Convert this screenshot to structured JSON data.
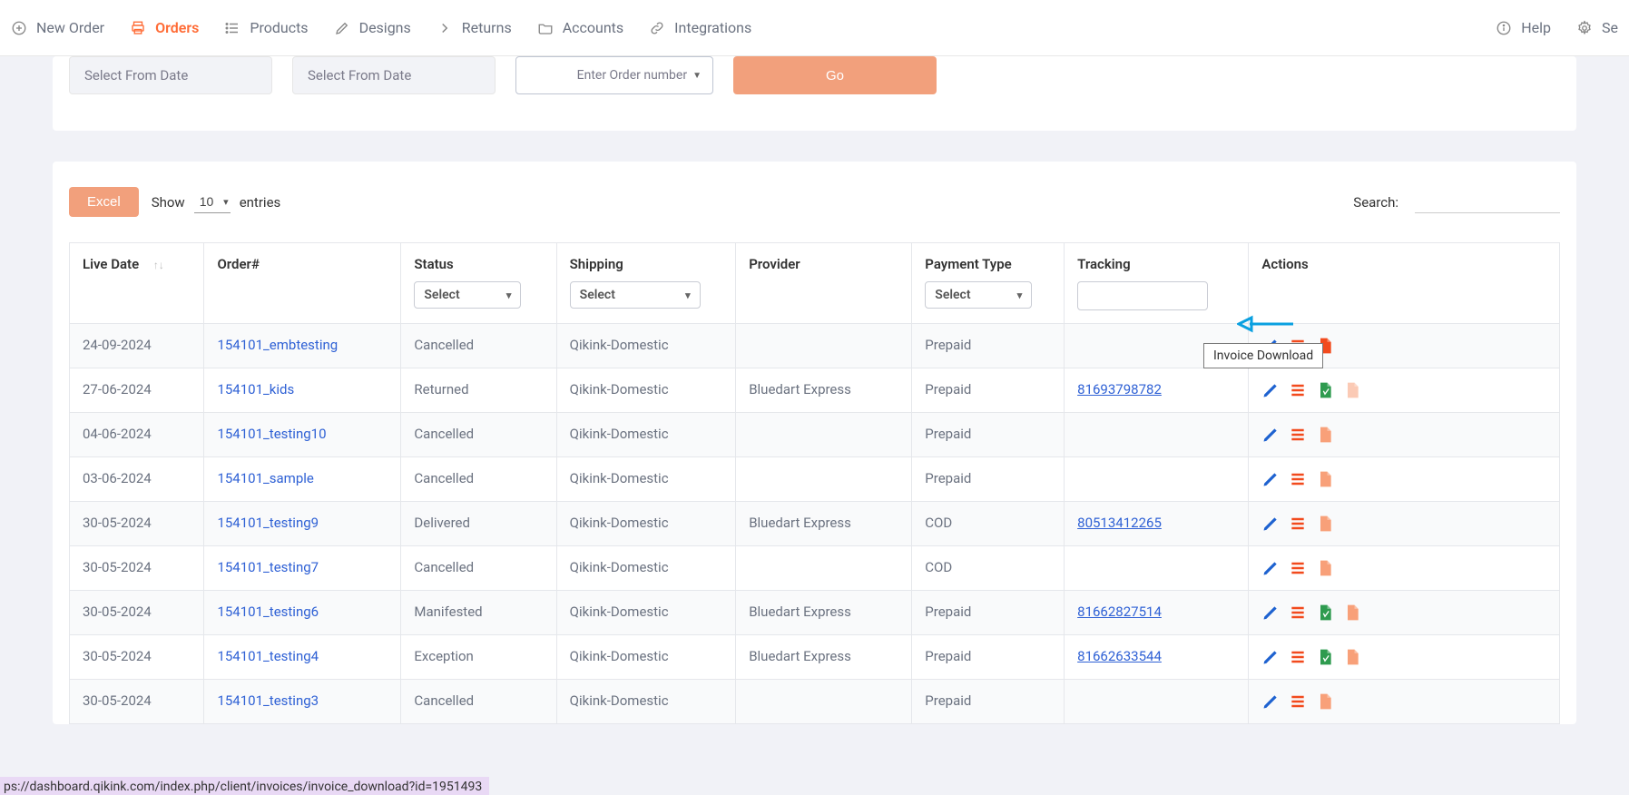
{
  "nav": {
    "new_order": "New Order",
    "orders": "Orders",
    "products": "Products",
    "designs": "Designs",
    "returns": "Returns",
    "accounts": "Accounts",
    "integrations": "Integrations",
    "help": "Help",
    "settings_short": "Se"
  },
  "filters": {
    "from_date": "Select From Date",
    "to_date": "Select From Date",
    "order_number_placeholder": "Enter Order number",
    "go": "Go"
  },
  "table_controls": {
    "excel": "Excel",
    "show": "Show",
    "entries_value": "10",
    "entries_label": "entries",
    "search_label": "Search:"
  },
  "columns": {
    "live_date": "Live Date",
    "order": "Order#",
    "status": "Status",
    "shipping": "Shipping",
    "provider": "Provider",
    "payment_type": "Payment Type",
    "tracking": "Tracking",
    "actions": "Actions",
    "select_placeholder": "Select"
  },
  "rows": [
    {
      "date": "24-09-2024",
      "order": "154101_embtesting",
      "status": "Cancelled",
      "shipping": "Qikink-Domestic",
      "provider": "",
      "payment": "Prepaid",
      "tracking": "",
      "has_pdf": false,
      "invoice_solid": true
    },
    {
      "date": "27-06-2024",
      "order": "154101_kids",
      "status": "Returned",
      "shipping": "Qikink-Domestic",
      "provider": "Bluedart Express",
      "payment": "Prepaid",
      "tracking": "81693798782",
      "has_pdf": true,
      "invoice_solid": false
    },
    {
      "date": "04-06-2024",
      "order": "154101_testing10",
      "status": "Cancelled",
      "shipping": "Qikink-Domestic",
      "provider": "",
      "payment": "Prepaid",
      "tracking": "",
      "has_pdf": false,
      "invoice_solid": false
    },
    {
      "date": "03-06-2024",
      "order": "154101_sample",
      "status": "Cancelled",
      "shipping": "Qikink-Domestic",
      "provider": "",
      "payment": "Prepaid",
      "tracking": "",
      "has_pdf": false,
      "invoice_solid": false
    },
    {
      "date": "30-05-2024",
      "order": "154101_testing9",
      "status": "Delivered",
      "shipping": "Qikink-Domestic",
      "provider": "Bluedart Express",
      "payment": "COD",
      "tracking": "80513412265",
      "has_pdf": false,
      "invoice_solid": false
    },
    {
      "date": "30-05-2024",
      "order": "154101_testing7",
      "status": "Cancelled",
      "shipping": "Qikink-Domestic",
      "provider": "",
      "payment": "COD",
      "tracking": "",
      "has_pdf": false,
      "invoice_solid": false
    },
    {
      "date": "30-05-2024",
      "order": "154101_testing6",
      "status": "Manifested",
      "shipping": "Qikink-Domestic",
      "provider": "Bluedart Express",
      "payment": "Prepaid",
      "tracking": "81662827514",
      "has_pdf": true,
      "invoice_solid": false
    },
    {
      "date": "30-05-2024",
      "order": "154101_testing4",
      "status": "Exception",
      "shipping": "Qikink-Domestic",
      "provider": "Bluedart Express",
      "payment": "Prepaid",
      "tracking": "81662633544",
      "has_pdf": true,
      "invoice_solid": false
    },
    {
      "date": "30-05-2024",
      "order": "154101_testing3",
      "status": "Cancelled",
      "shipping": "Qikink-Domestic",
      "provider": "",
      "payment": "Prepaid",
      "tracking": "",
      "has_pdf": false,
      "invoice_solid": false
    }
  ],
  "tooltip": "Invoice Download",
  "status_bar": "ps://dashboard.qikink.com/index.php/client/invoices/invoice_download?id=1951493"
}
